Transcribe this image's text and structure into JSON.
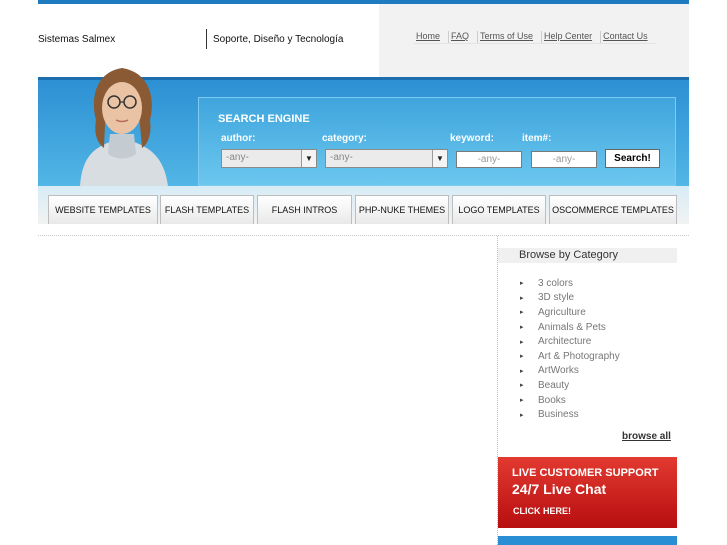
{
  "header": {
    "brand": "Sistemas Salmex",
    "slogan": "Soporte, Diseño y Tecnología",
    "links": [
      "Home",
      "FAQ",
      "Terms of Use",
      "Help Center",
      "Contact Us"
    ]
  },
  "search": {
    "title": "SEARCH ENGINE",
    "author_label": "author:",
    "category_label": "category:",
    "keyword_label": "keyword:",
    "item_label": "item#:",
    "author_value": "-any-",
    "category_value": "-any-",
    "keyword_value": "-any-",
    "item_value": "-any-",
    "button": "Search!"
  },
  "tabs": [
    "WEBSITE TEMPLATES",
    "FLASH TEMPLATES",
    "FLASH INTROS",
    "PHP-NUKE THEMES",
    "LOGO TEMPLATES",
    "OSCOMMERCE TEMPLATES"
  ],
  "sidebar": {
    "title": "Browse by Category",
    "categories": [
      "3 colors",
      "3D style",
      "Agriculture",
      "Animals & Pets",
      "Architecture",
      "Art & Photography",
      "ArtWorks",
      "Beauty",
      "Books",
      "Business"
    ],
    "browse_all": "browse all"
  },
  "support": {
    "line1": "LIVE CUSTOMER SUPPORT",
    "line2": "24/7 Live Chat",
    "line3": "CLICK HERE!"
  },
  "colors": {
    "banner": "#2b8fd3",
    "support": "#c8211c"
  },
  "icons": {
    "bullet": "right-arrow-icon",
    "dropdown": "down-arrow-icon"
  }
}
